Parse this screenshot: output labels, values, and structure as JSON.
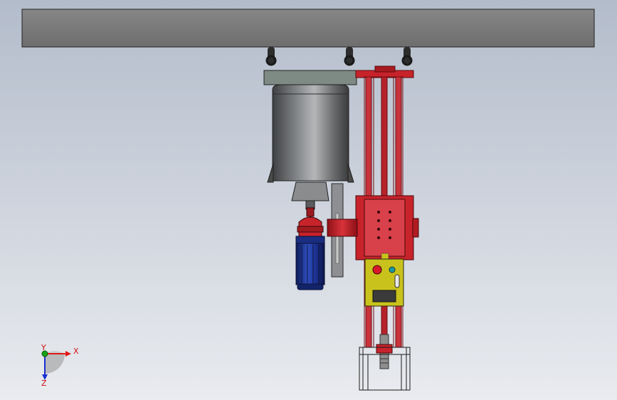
{
  "viewport": {
    "background_top": "#b3bccb",
    "background_bottom": "#e9ebef"
  },
  "colors": {
    "beam": "#7a7a7a",
    "frame_red": "#c8232b",
    "tank_gray": "#6d6f72",
    "motor_blue": "#1f3a9a",
    "control_box": "#c9c21d",
    "button_red": "#d9182a",
    "button_teal": "#1d9aa0"
  },
  "triad": {
    "x_label": "X",
    "y_label": "Y",
    "z_label": "Z",
    "x_color": "#e01818",
    "y_color": "#16a316",
    "z_color": "#1a2fd0"
  }
}
